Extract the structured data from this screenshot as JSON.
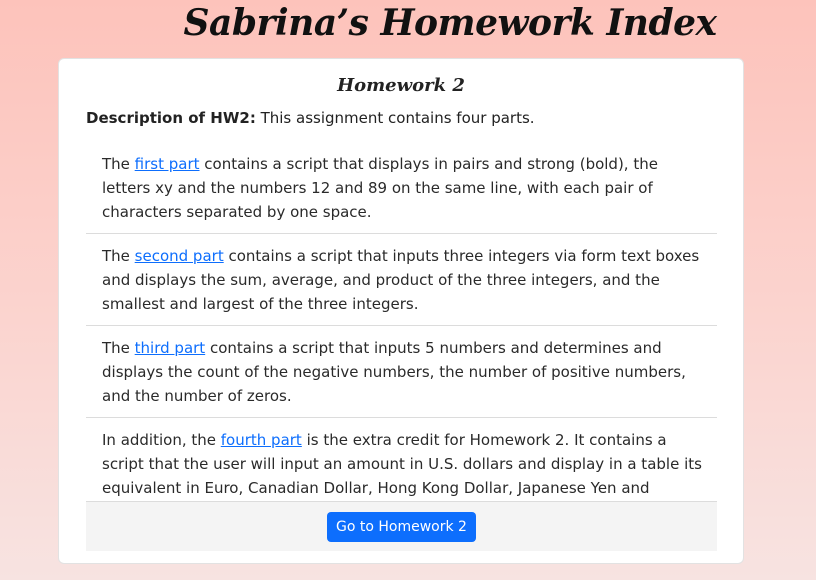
{
  "site_title": "Sabrina’s Homework Index",
  "card": {
    "title": "Homework 2",
    "description_label": "Description of HW2:",
    "description_text": " This assignment contains four parts.",
    "parts": [
      {
        "before": "The ",
        "link": "first part",
        "after": " contains a script that displays in pairs and strong (bold), the letters xy and the numbers 12 and 89 on the same line, with each pair of characters separated by one space."
      },
      {
        "before": "The ",
        "link": "second part",
        "after": " contains a script that inputs three integers via form text boxes and displays the sum, average, and product of the three integers, and the smallest and largest of the three integers."
      },
      {
        "before": "The ",
        "link": "third part",
        "after": " contains a script that inputs 5 numbers and determines and displays the count of the negative numbers, the number of positive numbers, and the number of zeros."
      },
      {
        "before": "In addition, the ",
        "link": "fourth part",
        "after": " is the extra credit for Homework 2. It contains a script that the user will input an amount in U.S. dollars and display in a table its equivalent in Euro, Canadian Dollar, Hong Kong Dollar, Japanese Yen and Mexican Peso."
      }
    ],
    "button_label": "Go to Homework 2"
  },
  "colors": {
    "link": "#0d6efd",
    "button": "#0d6efd",
    "background_top": "#fdc3bb",
    "background_bottom": "#f7e3e1"
  }
}
